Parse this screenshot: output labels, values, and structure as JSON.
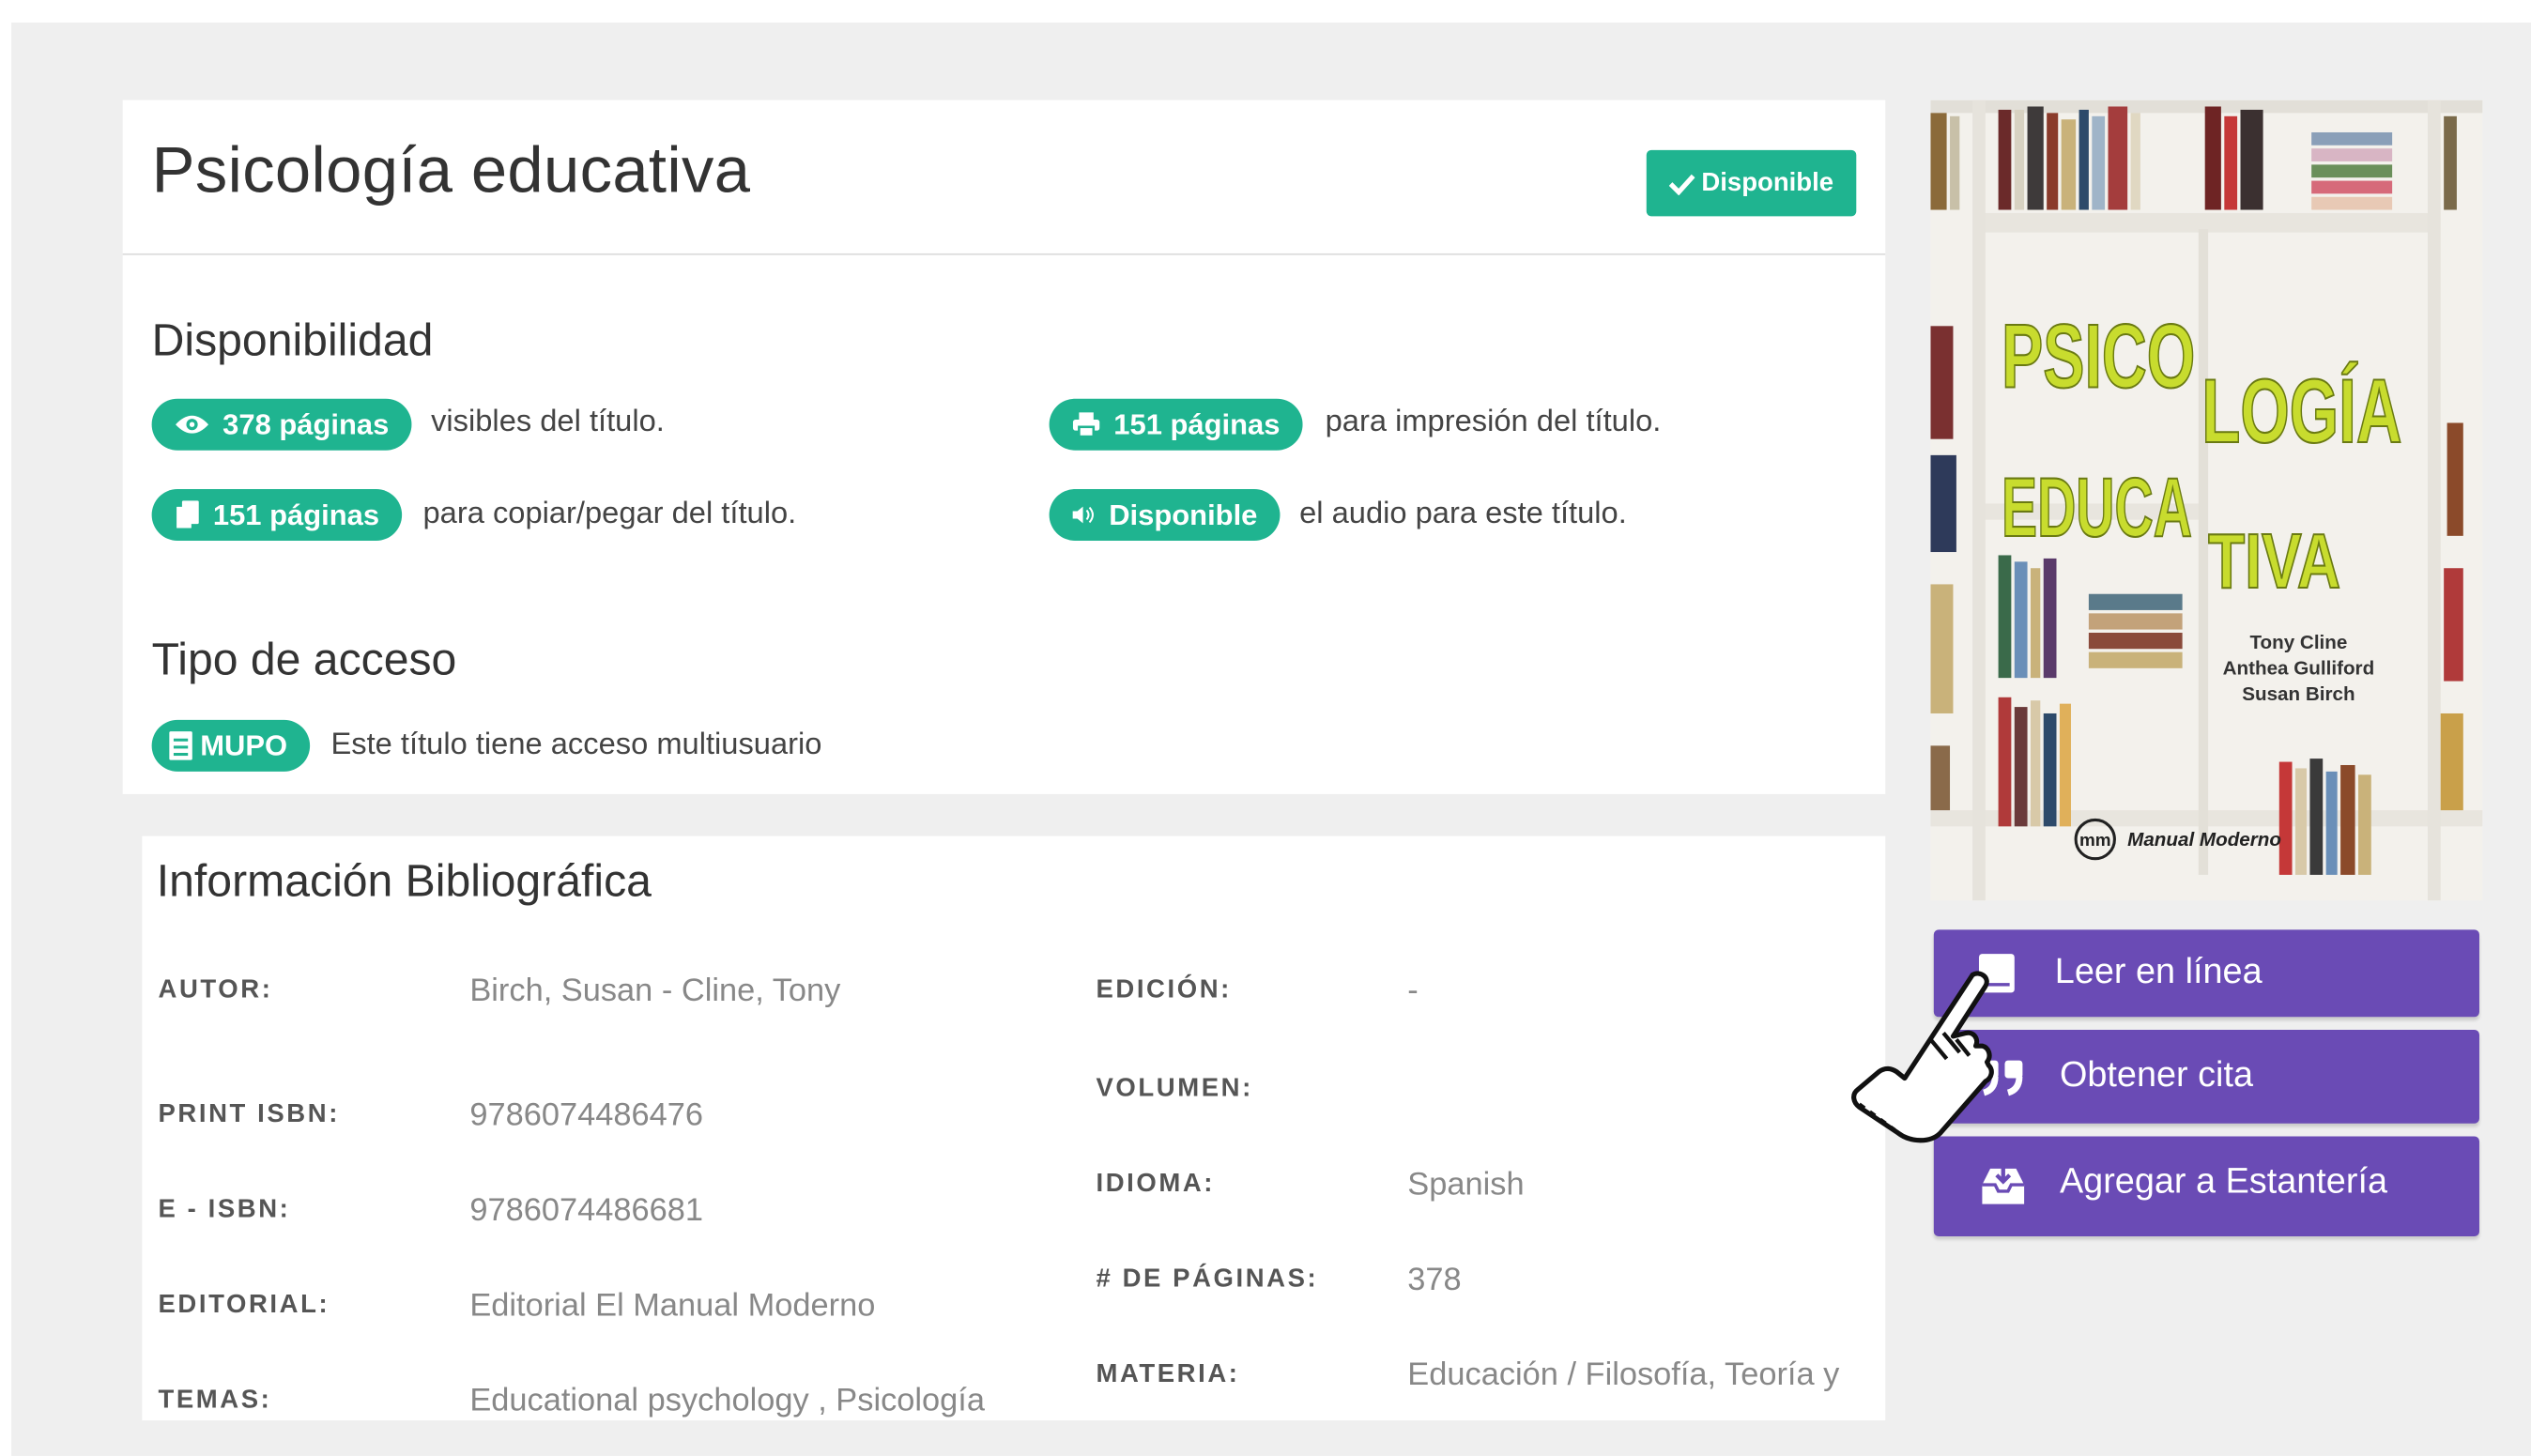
{
  "book": {
    "title": "Psicología educativa",
    "status_label": "Disponible"
  },
  "availability": {
    "heading": "Disponibilidad",
    "items": [
      {
        "icon": "eye-icon",
        "badge": "378 páginas",
        "text": "visibles del título."
      },
      {
        "icon": "printer-icon",
        "badge": "151 páginas",
        "text": "para impresión del título."
      },
      {
        "icon": "copy-icon",
        "badge": "151 páginas",
        "text": "para copiar/pegar del título."
      },
      {
        "icon": "speaker-icon",
        "badge": "Disponible",
        "text": "el audio para este título."
      }
    ]
  },
  "access": {
    "heading": "Tipo de acceso",
    "badge": "MUPO",
    "text": "Este título tiene acceso multiusuario"
  },
  "bibliography": {
    "heading": "Información Bibliográfica",
    "left": [
      {
        "label": "AUTOR:",
        "value": "Birch, Susan - Cline, Tony"
      },
      {
        "label": "PRINT ISBN:",
        "value": "9786074486476"
      },
      {
        "label": "E - ISBN:",
        "value": "9786074486681"
      },
      {
        "label": "EDITORIAL:",
        "value": "Editorial El Manual Moderno"
      },
      {
        "label": "TEMAS:",
        "value": "Educational psychology , Psicología"
      }
    ],
    "right": [
      {
        "label": "EDICIÓN:",
        "value": "-"
      },
      {
        "label": "VOLUMEN:",
        "value": ""
      },
      {
        "label": "IDIOMA:",
        "value": "Spanish"
      },
      {
        "label": "# DE PÁGINAS:",
        "value": "378"
      },
      {
        "label": "MATERIA:",
        "value": "Educación / Filosofía, Teoría y"
      }
    ]
  },
  "cover": {
    "title_lines": [
      "PSICO",
      "LOGÍA",
      "EDUCA",
      "TIVA"
    ],
    "authors": [
      "Tony Cline",
      "Anthea Gulliford",
      "Susan Birch"
    ],
    "publisher": "Manual Moderno",
    "publisher_mark": "mm"
  },
  "actions": [
    {
      "icon": "book-icon",
      "label": "Leer en línea"
    },
    {
      "icon": "quote-icon",
      "label": "Obtener cita"
    },
    {
      "icon": "inbox-download-icon",
      "label": "Agregar a Estantería"
    }
  ],
  "colors": {
    "accent_green": "#1fb490",
    "button_purple": "#6a4bb5",
    "cover_title_yellow": "#c8dc2e"
  }
}
